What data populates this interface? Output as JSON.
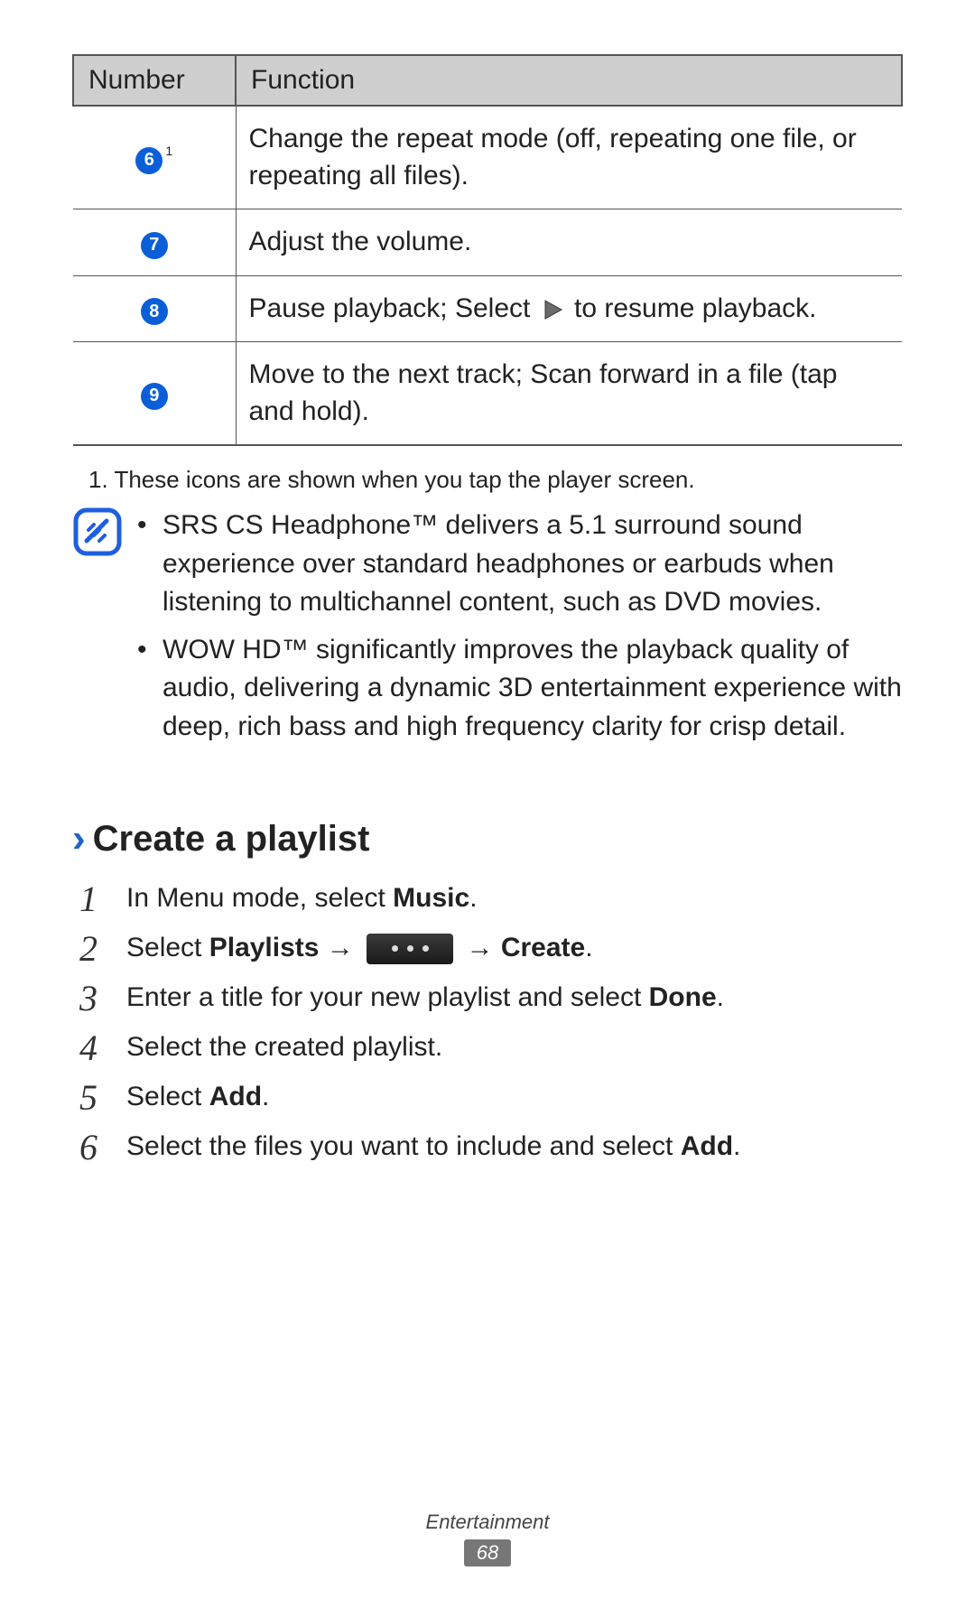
{
  "table": {
    "headers": {
      "number": "Number",
      "function": "Function"
    },
    "rows": [
      {
        "num": "6",
        "footref": "1",
        "func_a": "Change the repeat mode (off, repeating one file, or repeating all files)."
      },
      {
        "num": "7",
        "func_a": "Adjust the volume."
      },
      {
        "num": "8",
        "func_a": "Pause playback; Select ",
        "func_b": " to resume playback."
      },
      {
        "num": "9",
        "func_a": "Move to the next track; Scan forward in a file (tap and hold)."
      }
    ]
  },
  "footnote": "1.  These icons are shown when you tap the player screen.",
  "notes": [
    "SRS CS Headphone™ delivers a 5.1 surround sound experience over standard headphones or earbuds when listening to multichannel content, such as DVD movies.",
    "WOW HD™ significantly improves the playback quality of audio, delivering a dynamic 3D entertainment experience with deep, rich bass and high frequency clarity for crisp detail."
  ],
  "section": {
    "title": "Create a playlist",
    "steps": {
      "s1a": "In Menu mode, select ",
      "s1b": "Music",
      "s1c": ".",
      "s2a": "Select ",
      "s2b": "Playlists",
      "s2c": " → ",
      "s2d": " → ",
      "s2e": "Create",
      "s2f": ".",
      "s3a": "Enter a title for your new playlist and select ",
      "s3b": "Done",
      "s3c": ".",
      "s4a": "Select the created playlist.",
      "s5a": "Select ",
      "s5b": "Add",
      "s5c": ".",
      "s6a": "Select the files you want to include and select ",
      "s6b": "Add",
      "s6c": "."
    }
  },
  "footer": {
    "category": "Entertainment",
    "page": "68"
  }
}
